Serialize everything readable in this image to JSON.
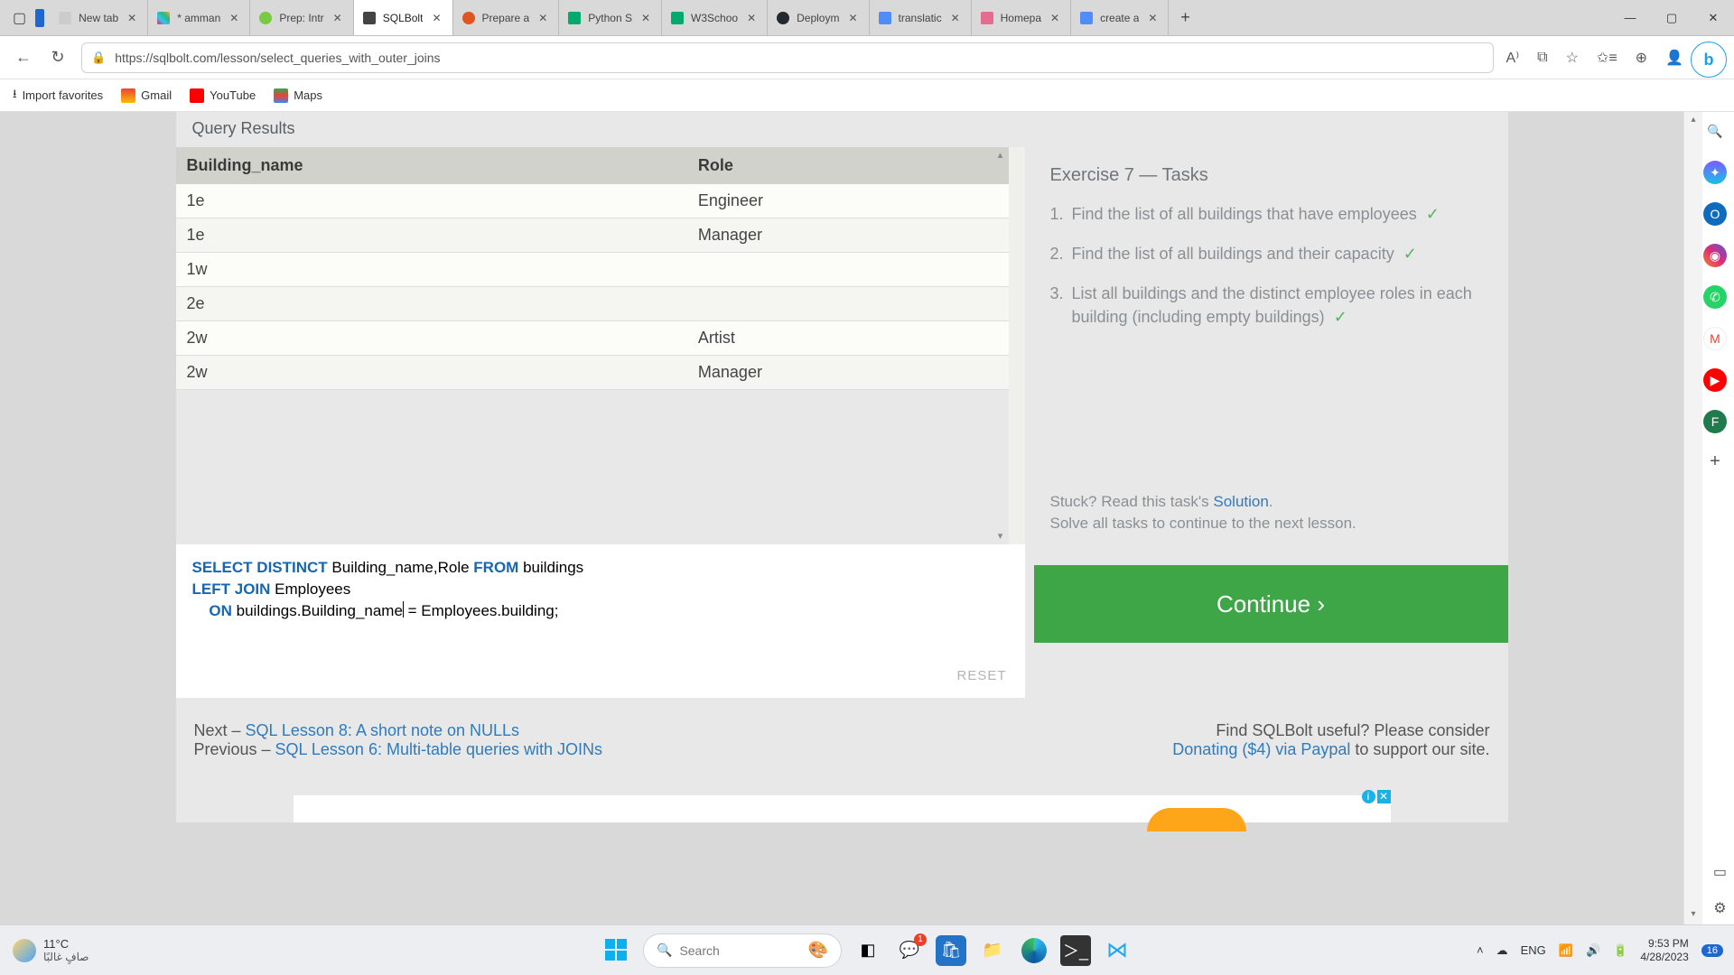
{
  "window": {
    "tabs": [
      {
        "title": "New tab"
      },
      {
        "title": "* amman"
      },
      {
        "title": "Prep: Intr"
      },
      {
        "title": "SQLBolt",
        "active": true
      },
      {
        "title": "Prepare a"
      },
      {
        "title": "Python S"
      },
      {
        "title": "W3Schoo"
      },
      {
        "title": "Deploym"
      },
      {
        "title": "translatic"
      },
      {
        "title": "Homepa"
      },
      {
        "title": "create a"
      }
    ]
  },
  "address": {
    "url": "https://sqlbolt.com/lesson/select_queries_with_outer_joins"
  },
  "favorites": {
    "import": "Import favorites",
    "items": [
      "Gmail",
      "YouTube",
      "Maps"
    ]
  },
  "page": {
    "results_label": "Query Results",
    "table": {
      "headers": [
        "Building_name",
        "Role"
      ],
      "rows": [
        [
          "1e",
          "Engineer"
        ],
        [
          "1e",
          "Manager"
        ],
        [
          "1w",
          ""
        ],
        [
          "2e",
          ""
        ],
        [
          "2w",
          "Artist"
        ],
        [
          "2w",
          "Manager"
        ]
      ]
    },
    "sql": {
      "l1a": "SELECT",
      "l1b": "DISTINCT",
      "l1c": " Building_name,Role ",
      "l1d": "FROM",
      "l1e": " buildings",
      "l2a": "LEFT",
      "l2b": "JOIN",
      "l2c": " Employees",
      "l3a": "ON",
      "l3b": " buildings.Building_name",
      "l3c": " = Employees.building;"
    },
    "reset": "RESET",
    "tasks": {
      "title": "Exercise 7 — Tasks",
      "items": [
        "Find the list of all buildings that have employees",
        "Find the list of all buildings and their capacity",
        "List all buildings and the distinct employee roles in each building (including empty buildings)"
      ]
    },
    "help": {
      "stuck": "Stuck? Read this task's ",
      "solution": "Solution",
      "period": ".",
      "solve": "Solve all tasks to continue to the next lesson."
    },
    "continue": "Continue ›",
    "footer": {
      "next_label": "Next – ",
      "next_link": "SQL Lesson 8: A short note on NULLs",
      "prev_label": "Previous – ",
      "prev_link": "SQL Lesson 6: Multi-table queries with JOINs",
      "useful": "Find SQLBolt useful? Please consider",
      "donate": "Donating ($4) via Paypal",
      "support": " to support our site."
    }
  },
  "taskbar": {
    "weather_temp": "11°C",
    "weather_desc": "صافٍ غالبًا",
    "search_placeholder": "Search",
    "lang": "ENG",
    "time": "9:53 PM",
    "date": "4/28/2023",
    "notif": "16"
  },
  "chart_data": {
    "type": "table",
    "headers": [
      "Building_name",
      "Role"
    ],
    "rows": [
      [
        "1e",
        "Engineer"
      ],
      [
        "1e",
        "Manager"
      ],
      [
        "1w",
        ""
      ],
      [
        "2e",
        ""
      ],
      [
        "2w",
        "Artist"
      ],
      [
        "2w",
        "Manager"
      ]
    ]
  }
}
